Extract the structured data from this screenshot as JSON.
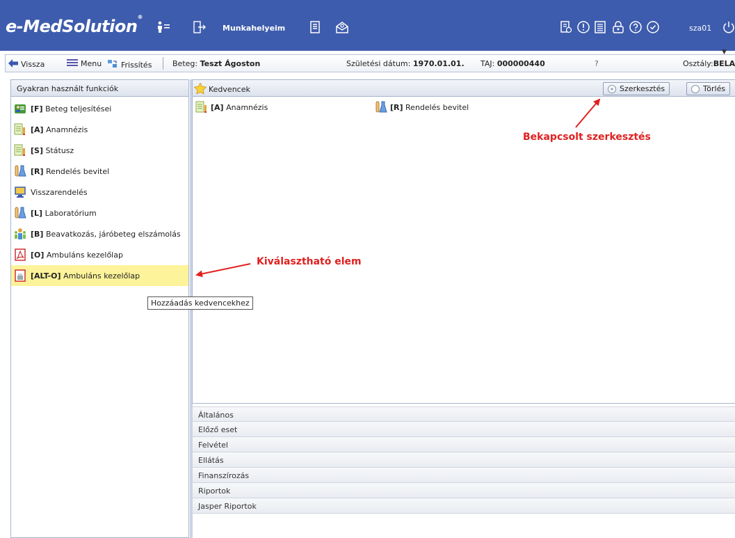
{
  "app": {
    "logo": "e-MedSolution",
    "logo_mark": "®",
    "nav_label": "Munkahelyeim",
    "user": "sza01",
    "accent_color": "#3e5cad",
    "icons": [
      "person-list-icon",
      "logout-icon",
      "document-icon",
      "mail-icon",
      "report-icon",
      "info-icon",
      "calculator-icon",
      "lock-icon",
      "help-icon",
      "check-icon",
      "power-icon"
    ]
  },
  "toolbar": {
    "back_label": "Vissza",
    "menu_label": "Menu",
    "refresh_label": "Frissítés",
    "patient_label": "Beteg:",
    "patient_name": "Teszt Ágoston",
    "dob_label": "Születési dátum:",
    "dob_value": "1970.01.01.",
    "taj_label": "TAJ:",
    "taj_value": "000000440",
    "question": "?",
    "dept_label": "Osztály:",
    "dept_value": "BELA"
  },
  "left_panel": {
    "title": "Gyakran használt funkciók",
    "items": [
      {
        "key": "[F]",
        "label": "Beteg teljesítései",
        "icon": "patient-performance-icon"
      },
      {
        "key": "[A]",
        "label": "Anamnézis",
        "icon": "notepad-icon"
      },
      {
        "key": "[S]",
        "label": "Státusz",
        "icon": "notepad-icon"
      },
      {
        "key": "[R]",
        "label": "Rendelés bevitel",
        "icon": "lab-flask-icon"
      },
      {
        "key": "",
        "label": "Visszarendelés",
        "icon": "computer-icon"
      },
      {
        "key": "[L]",
        "label": "Laboratórium",
        "icon": "lab-flask-icon"
      },
      {
        "key": "[B]",
        "label": "Beavatkozás, járóbeteg elszámolás",
        "icon": "people-icon"
      },
      {
        "key": "[O]",
        "label": "Ambuláns kezelőlap",
        "icon": "pdf-icon"
      },
      {
        "key": "[ALT-O]",
        "label": "Ambuláns kezelőlap",
        "icon": "pdf-print-icon"
      }
    ]
  },
  "right_panel": {
    "title": "Kedvencek",
    "edit_button": "Szerkesztés",
    "delete_button": "Törlés",
    "favorites": [
      {
        "key": "[A]",
        "label": "Anamnézis",
        "icon": "notepad-icon"
      },
      {
        "key": "[R]",
        "label": "Rendelés bevitel",
        "icon": "lab-flask-icon"
      }
    ]
  },
  "accordion": [
    "Általános",
    "Előző eset",
    "Felvétel",
    "Ellátás",
    "Finanszírozás",
    "Riportok",
    "Jasper Riportok"
  ],
  "tooltip": "Hozzáadás kedvencekhez",
  "annotations": {
    "edit_on": "Bekapcsolt szerkesztés",
    "selectable": "Kiválasztható elem",
    "color": "#e02020"
  }
}
